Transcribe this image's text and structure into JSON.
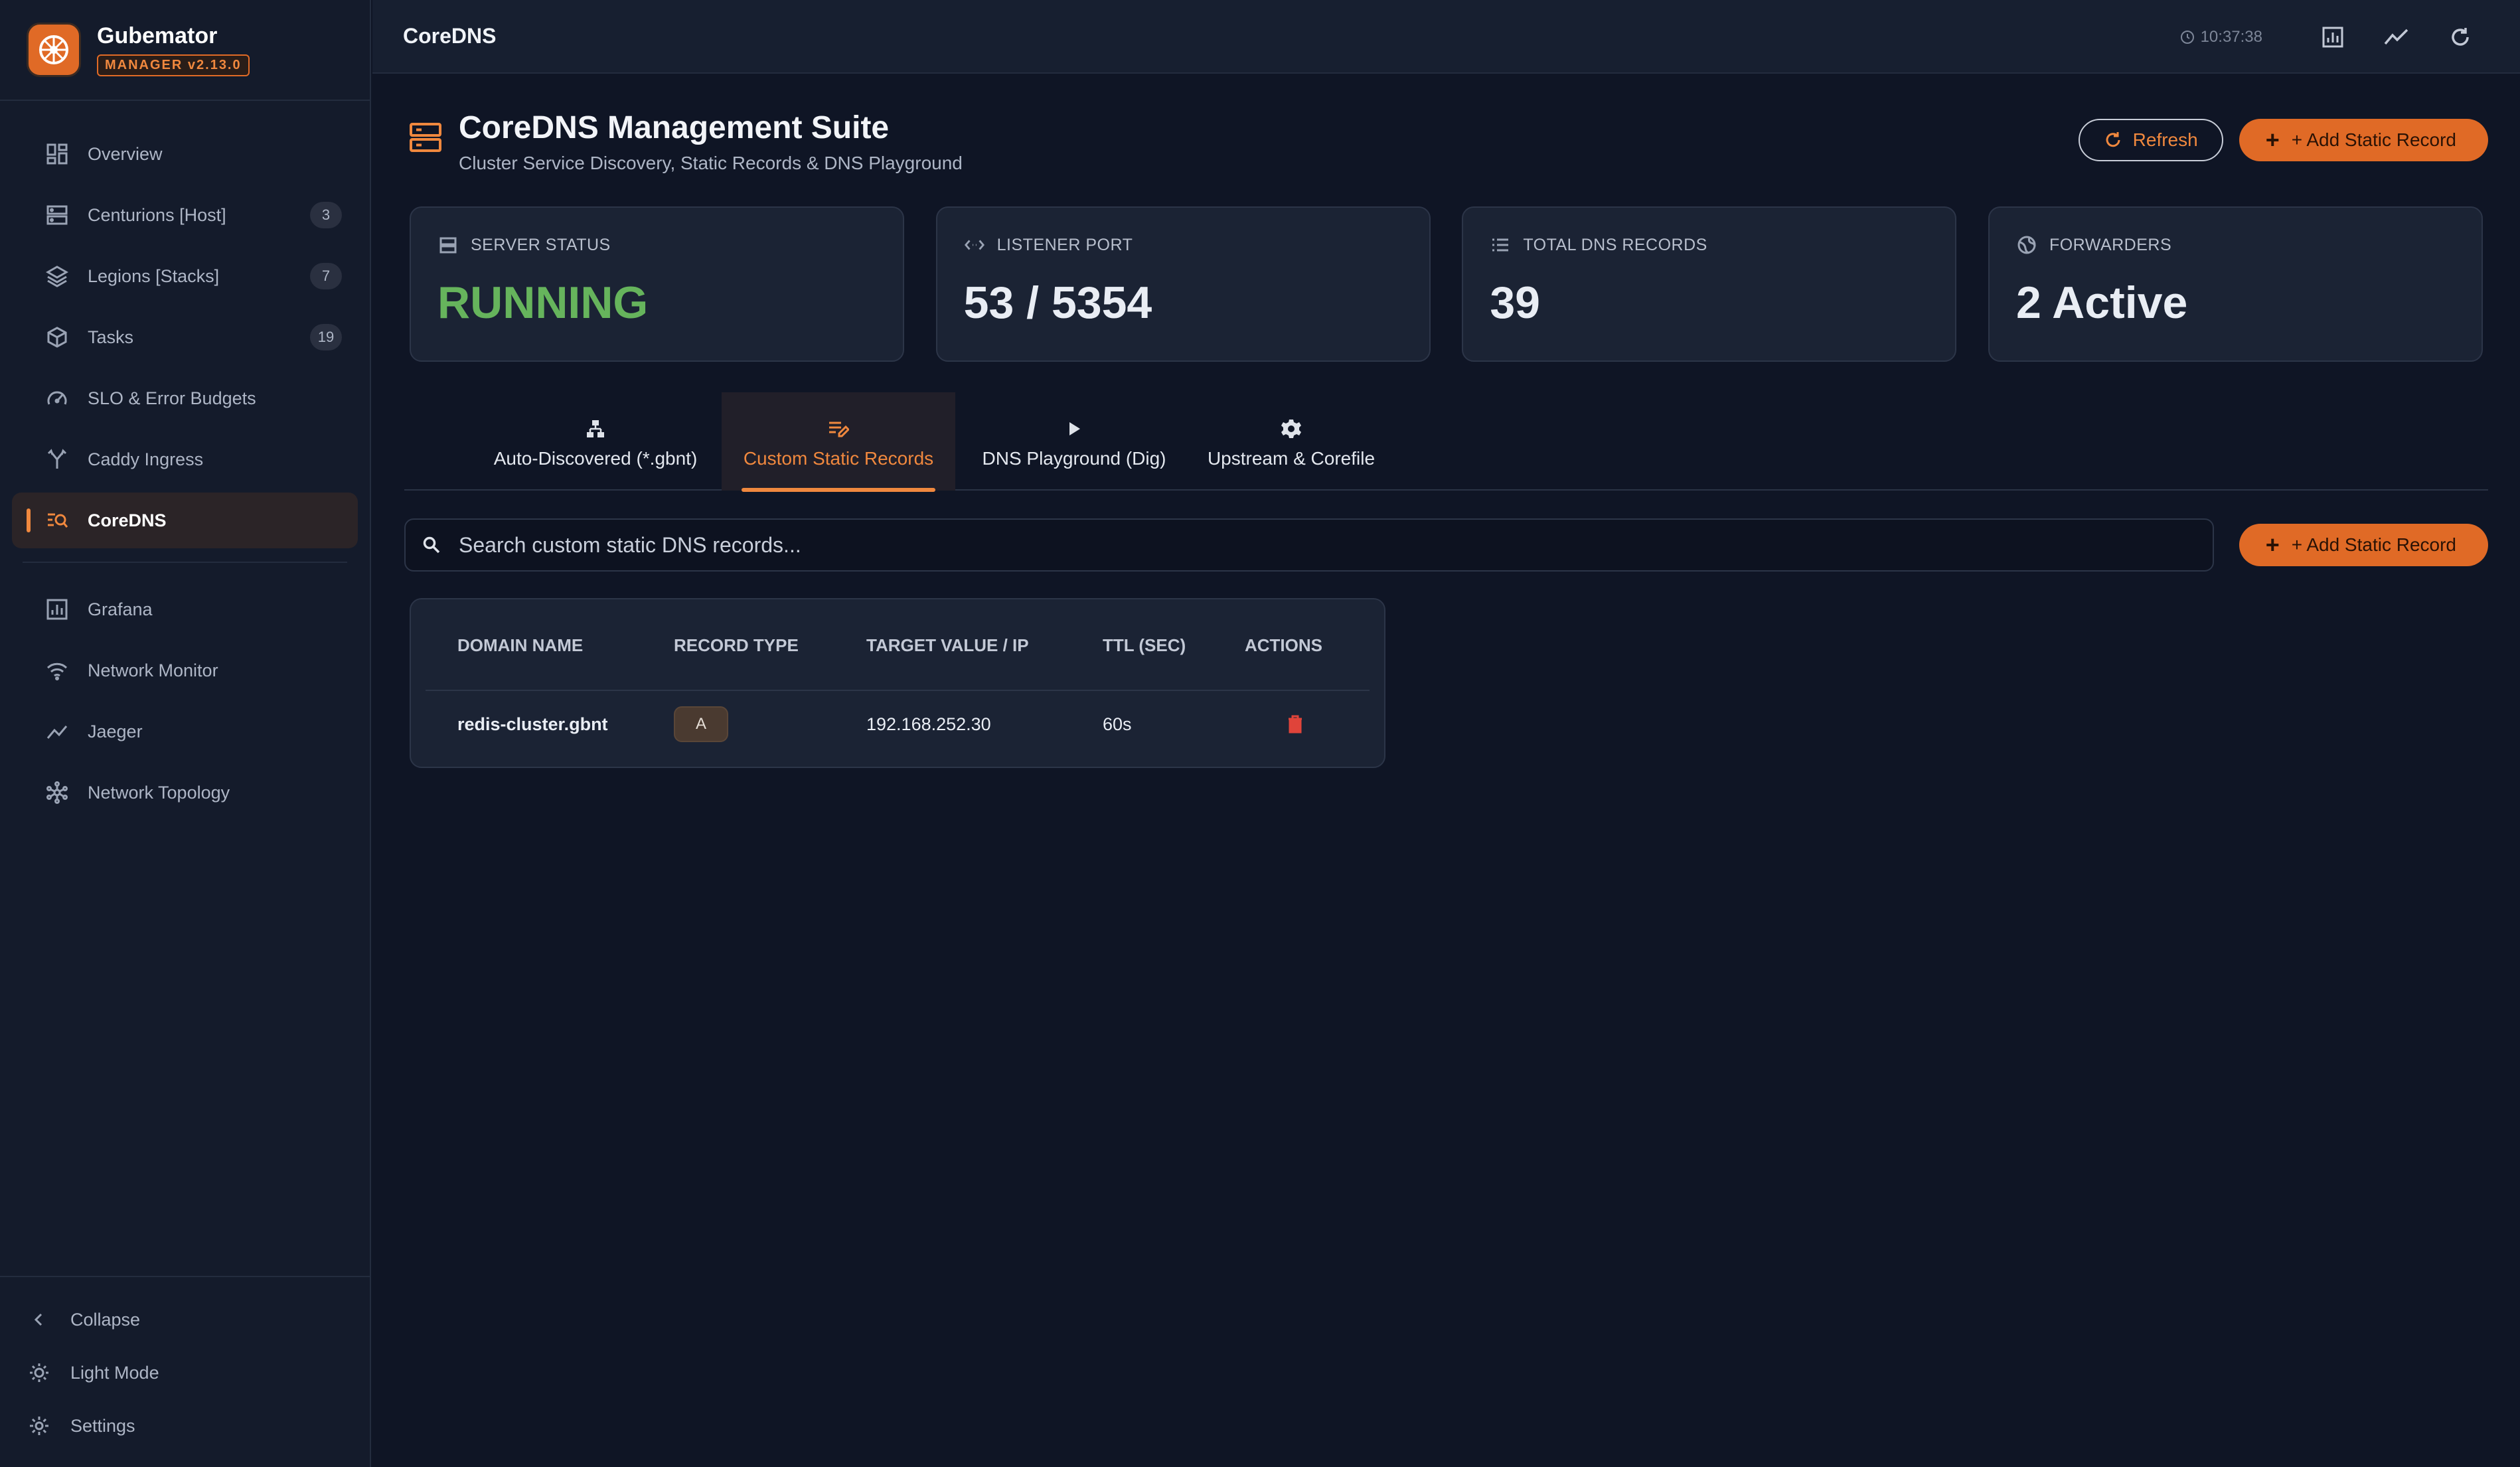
{
  "app": {
    "name": "Gubemator",
    "version": "MANAGER v2.13.0"
  },
  "sidebar": {
    "items": [
      {
        "label": "Overview",
        "icon": "dashboard-icon"
      },
      {
        "label": "Centurions [Host]",
        "icon": "server-icon",
        "badge": "3"
      },
      {
        "label": "Legions [Stacks]",
        "icon": "layers-icon",
        "badge": "7"
      },
      {
        "label": "Tasks",
        "icon": "cube-icon",
        "badge": "19"
      },
      {
        "label": "SLO & Error Budgets",
        "icon": "gauge-icon"
      },
      {
        "label": "Caddy Ingress",
        "icon": "fork-icon"
      },
      {
        "label": "CoreDNS",
        "icon": "dns-search-icon"
      },
      {
        "label": "Grafana",
        "icon": "chart-icon"
      },
      {
        "label": "Network Monitor",
        "icon": "wifi-icon"
      },
      {
        "label": "Jaeger",
        "icon": "trend-icon"
      },
      {
        "label": "Network Topology",
        "icon": "topology-icon"
      }
    ],
    "bottom": {
      "collapse": "Collapse",
      "theme": "Light Mode",
      "settings": "Settings"
    }
  },
  "topbar": {
    "title": "CoreDNS",
    "time": "10:37:38"
  },
  "header": {
    "title": "CoreDNS Management Suite",
    "subtitle": "Cluster Service Discovery, Static Records & DNS Playground",
    "refresh_label": "Refresh",
    "add_label": "+ Add Static Record"
  },
  "stats": [
    {
      "label": "SERVER STATUS",
      "value": "RUNNING",
      "icon": "server-status-icon"
    },
    {
      "label": "LISTENER PORT",
      "value": "53 / 5354",
      "icon": "code-icon"
    },
    {
      "label": "TOTAL DNS RECORDS",
      "value": "39",
      "icon": "list-icon"
    },
    {
      "label": "FORWARDERS",
      "value": "2 Active",
      "icon": "globe-icon"
    }
  ],
  "tabs": [
    {
      "label": "Auto-Discovered (*.gbnt)",
      "icon": "hierarchy-icon"
    },
    {
      "label": "Custom Static Records",
      "icon": "edit-list-icon",
      "active": true
    },
    {
      "label": "DNS Playground (Dig)",
      "icon": "play-icon"
    },
    {
      "label": "Upstream & Corefile",
      "icon": "gear-icon"
    }
  ],
  "search": {
    "placeholder": "Search custom static DNS records...",
    "add_label": "+ Add Static Record"
  },
  "table": {
    "columns": [
      "DOMAIN NAME",
      "RECORD TYPE",
      "TARGET VALUE / IP",
      "TTL (SEC)",
      "ACTIONS"
    ],
    "rows": [
      {
        "domain": "redis-cluster.gbnt",
        "type": "A",
        "target": "192.168.252.30",
        "ttl": "60s"
      }
    ]
  },
  "colors": {
    "accent": "#e06a26",
    "running": "#66b45c",
    "background": "#0f1525",
    "card": "#1b2334",
    "delete": "#e0443a"
  }
}
